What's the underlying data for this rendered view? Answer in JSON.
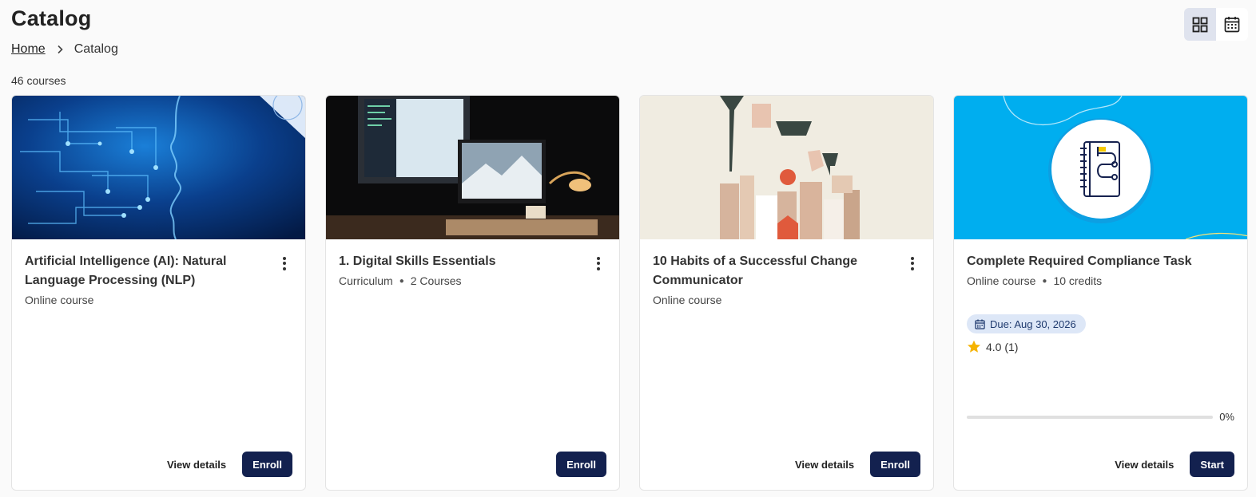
{
  "header": {
    "title": "Catalog",
    "breadcrumb": [
      {
        "label": "Home"
      },
      {
        "label": "Catalog"
      }
    ],
    "count_label": "46 courses",
    "view_toggle": [
      {
        "icon": "grid-view-icon",
        "active": true
      },
      {
        "icon": "calendar-view-icon",
        "active": false
      }
    ]
  },
  "colors": {
    "primary_button": "#13214f",
    "due_badge_bg": "#dde7f7",
    "star": "#f5b301"
  },
  "cards": [
    {
      "title": "Artificial Intelligence (AI): Natural Language Processing (NLP)",
      "meta": [
        "Online course"
      ],
      "actions": {
        "details": "View details",
        "primary": "Enroll"
      }
    },
    {
      "title": "1. Digital Skills Essentials",
      "meta": [
        "Curriculum",
        "2 Courses"
      ],
      "actions": {
        "primary": "Enroll"
      }
    },
    {
      "title": "10 Habits of a Successful Change Communicator",
      "meta": [
        "Online course"
      ],
      "actions": {
        "details": "View details",
        "primary": "Enroll"
      }
    },
    {
      "title": "Complete Required Compliance Task",
      "meta": [
        "Online course",
        "10 credits"
      ],
      "due": "Due: Aug 30, 2026",
      "rating": "4.0 (1)",
      "progress": {
        "value": 0,
        "label": "0%"
      },
      "actions": {
        "details": "View details",
        "primary": "Start"
      }
    }
  ]
}
